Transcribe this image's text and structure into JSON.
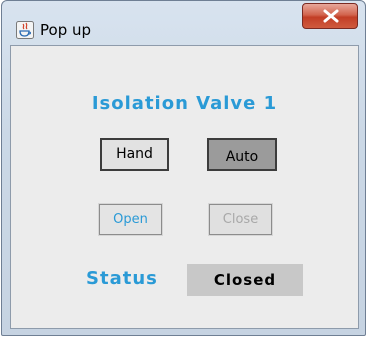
{
  "window": {
    "title": "Pop up",
    "app_icon": "java-app-icon",
    "close_icon": "close-icon"
  },
  "panel": {
    "title": "Isolation Valve 1",
    "mode_buttons": {
      "hand_label": "Hand",
      "auto_label": "Auto",
      "selected": "Auto"
    },
    "action_buttons": {
      "open_label": "Open",
      "close_label": "Close",
      "close_enabled": false
    },
    "status": {
      "label": "Status",
      "value": "Closed"
    }
  },
  "colors": {
    "accent_blue": "#2a9ad6",
    "close_button_red": "#c23e26",
    "panel_background": "#ececec",
    "status_background": "#c8c8c8"
  }
}
